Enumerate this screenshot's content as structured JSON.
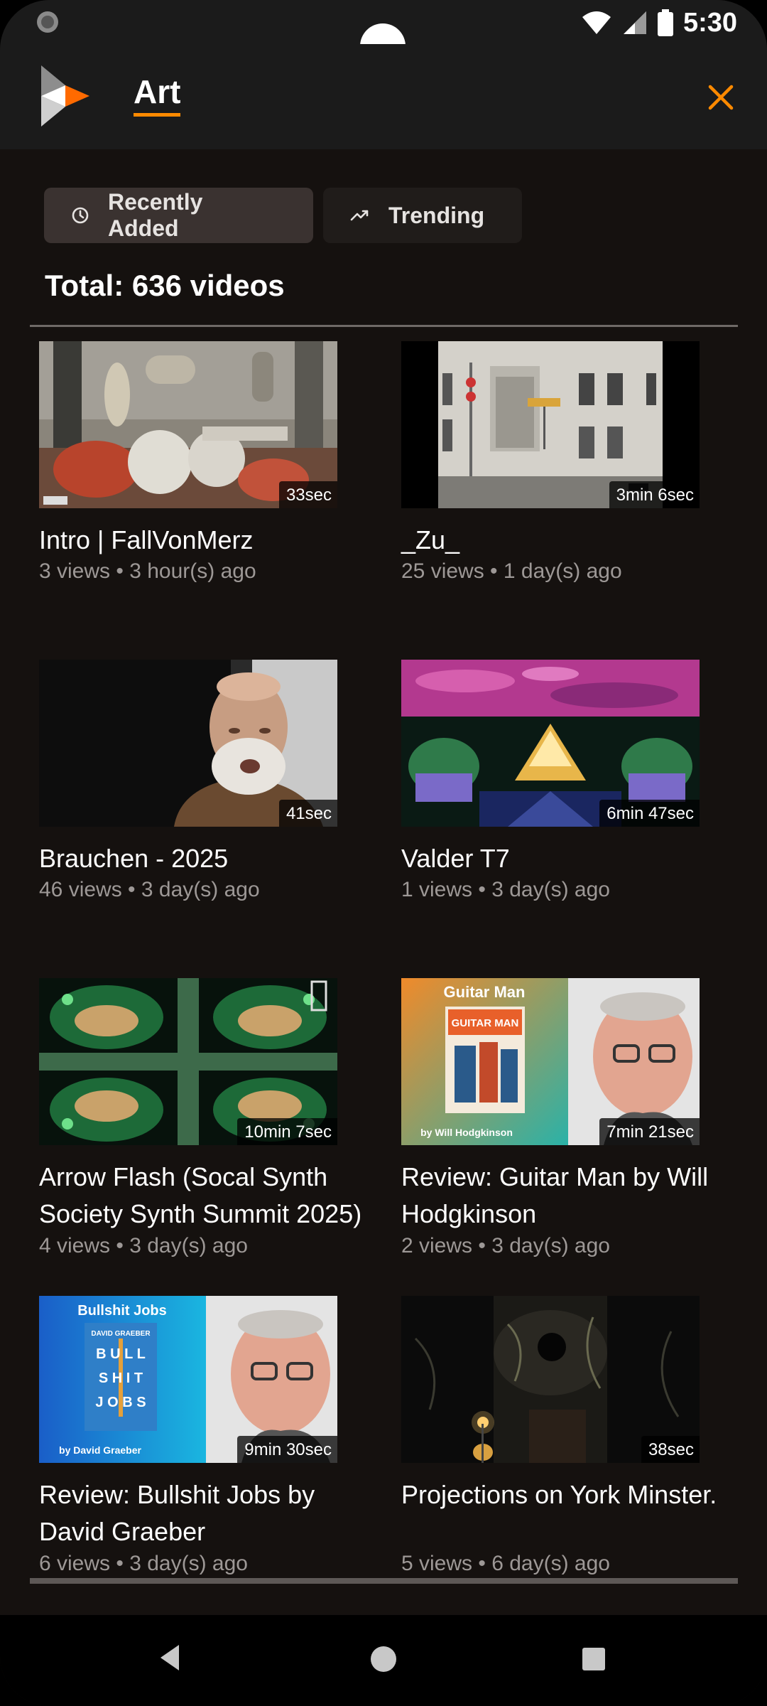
{
  "status_bar": {
    "time": "5:30"
  },
  "app_bar": {
    "title": "Art",
    "logo_icon": "play-logo-icon",
    "close_icon": "close-icon",
    "accent": "#ff8a00"
  },
  "filters": {
    "recently_added": {
      "label": "Recently Added",
      "icon": "clock-icon"
    },
    "trending": {
      "label": "Trending",
      "icon": "trending-icon"
    }
  },
  "total_label": "Total: 636 videos",
  "videos": [
    {
      "title": "Intro | FallVonMerz",
      "duration": "33sec",
      "meta": "3 views • 3 hour(s) ago"
    },
    {
      "title": "_Zu_",
      "duration": "3min 6sec",
      "meta": "25 views • 1 day(s) ago"
    },
    {
      "title": "Brauchen - 2025",
      "duration": "41sec",
      "meta": "46 views • 3 day(s) ago"
    },
    {
      "title": "Valder T7",
      "duration": "6min 47sec",
      "meta": "1 views • 3 day(s) ago"
    },
    {
      "title": "Arrow Flash (Socal Synth Society Synth Summit 2025)",
      "duration": "10min 7sec",
      "meta": "4 views • 3 day(s) ago"
    },
    {
      "title": "Review: Guitar Man by Will Hodgkinson",
      "duration": "7min 21sec",
      "meta": "2 views • 3 day(s) ago",
      "thumb_text": {
        "top": "Guitar Man",
        "book": "GUITAR MAN",
        "bottom": "by Will Hodgkinson"
      }
    },
    {
      "title": "Review: Bullshit Jobs by David Graeber",
      "duration": "9min 30sec",
      "meta": "6 views • 3 day(s) ago",
      "thumb_text": {
        "top": "Bullshit Jobs",
        "author": "DAVID GRAEBER",
        "book1": "B U L L",
        "book2": "S H I T",
        "book3": "J O B S",
        "bottom": "by David Graeber"
      }
    },
    {
      "title": "Projections on York Minster.",
      "duration": "38sec",
      "meta": "5 views • 6 day(s) ago"
    }
  ]
}
